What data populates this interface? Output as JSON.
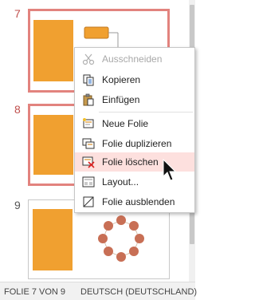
{
  "slides": [
    {
      "number": "7"
    },
    {
      "number": "8"
    },
    {
      "number": "9"
    }
  ],
  "context_menu": {
    "items": [
      {
        "label": "Ausschneiden",
        "icon": "scissors-icon",
        "disabled": true
      },
      {
        "label": "Kopieren",
        "icon": "copy-icon",
        "disabled": false
      },
      {
        "label": "Einfügen",
        "icon": "paste-icon",
        "disabled": false
      },
      {
        "label": "Neue Folie",
        "icon": "new-slide-icon",
        "disabled": false
      },
      {
        "label": "Folie duplizieren",
        "icon": "duplicate-slide-icon",
        "disabled": false
      },
      {
        "label": "Folie löschen",
        "icon": "delete-slide-icon",
        "disabled": false,
        "highlighted": true
      },
      {
        "label": "Layout...",
        "icon": "layout-icon",
        "disabled": false
      },
      {
        "label": "Folie ausblenden",
        "icon": "hide-slide-icon",
        "disabled": false
      }
    ]
  },
  "status_bar": {
    "slide_info": "FOLIE 7 VON 9",
    "language": "DEUTSCH (DEUTSCHLAND)"
  },
  "colors": {
    "accent": "#f0a030",
    "selection": "#e2837e",
    "slide_number": "#c0504d",
    "hover": "#fde0de"
  }
}
